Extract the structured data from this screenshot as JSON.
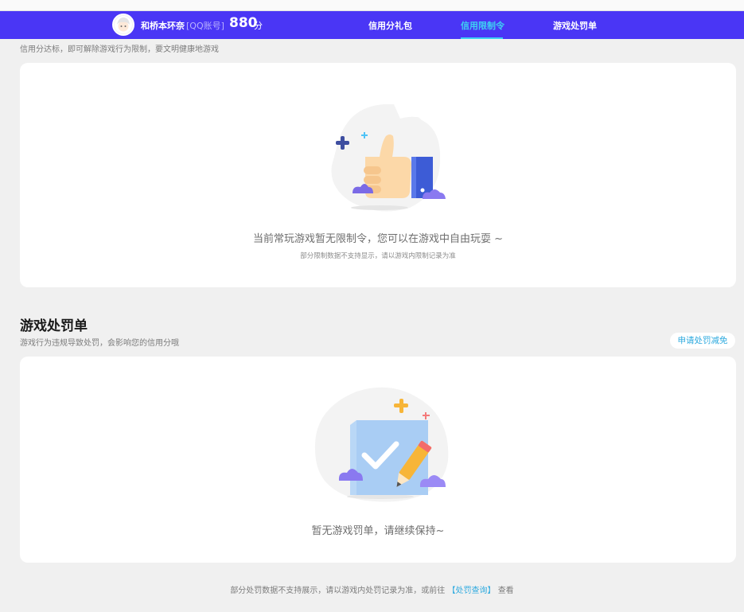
{
  "header": {
    "user_name": "和桥本环奈",
    "account_tag": "[QQ账号]",
    "score": "880",
    "score_unit": "分",
    "tabs": [
      {
        "label": "信用分礼包",
        "active": false
      },
      {
        "label": "信用限制令",
        "active": true
      },
      {
        "label": "游戏处罚单",
        "active": false
      }
    ]
  },
  "restriction": {
    "hint": "信用分达标，即可解除游戏行为限制，要文明健康地游戏",
    "empty_title": "当前常玩游戏暂无限制令，您可以在游戏中自由玩耍 ~",
    "empty_sub": "部分限制数据不支持显示，请以游戏内限制记录为准"
  },
  "penalty": {
    "title": "游戏处罚单",
    "subtitle": "游戏行为违规导致处罚，会影响您的信用分哦",
    "apply_button": "申请处罚减免",
    "empty_title": "暂无游戏罚单，请继续保持~"
  },
  "footer": {
    "text_before": "部分处罚数据不支持展示，请以游戏内处罚记录为准，或前往",
    "link": "【处罚查询】",
    "text_after": "查看"
  },
  "colors": {
    "nav_bg": "#4a36f5",
    "accent_cyan": "#3ed1f2",
    "link_blue": "#2eaadf"
  }
}
